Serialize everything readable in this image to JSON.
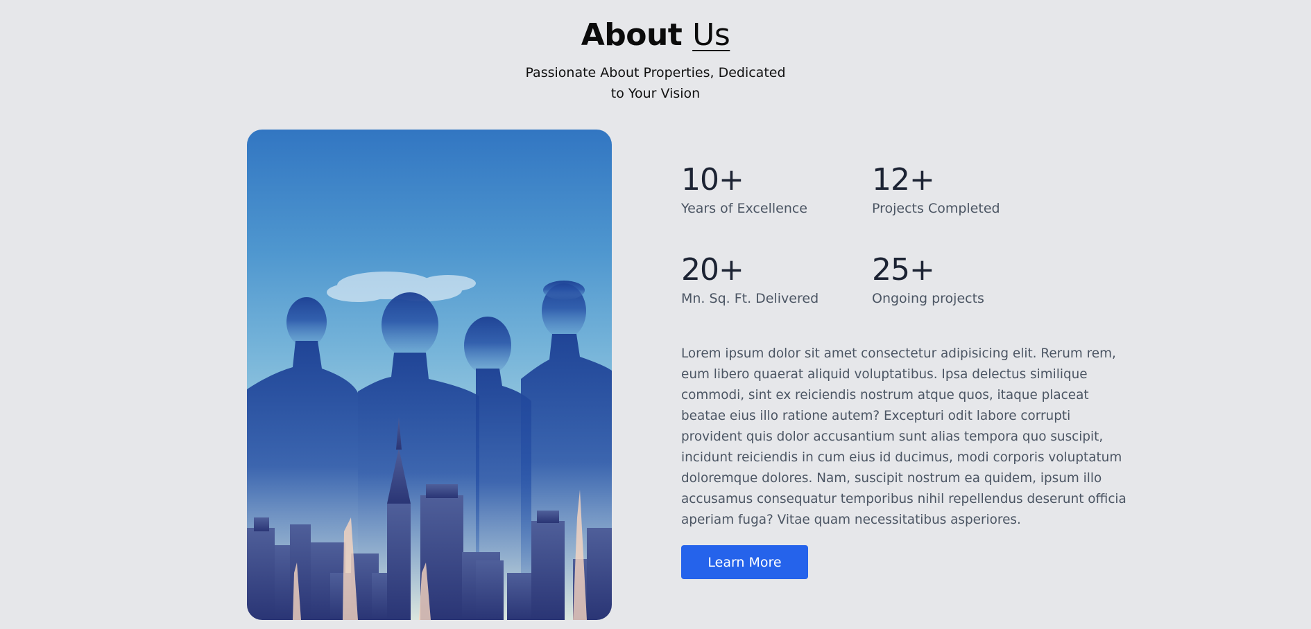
{
  "header": {
    "title_bold": "About",
    "title_light": "Us",
    "subtitle": "Passionate About Properties, Dedicated to Your Vision"
  },
  "stats": [
    {
      "value": "10+",
      "label": "Years of Excellence"
    },
    {
      "value": "12+",
      "label": "Projects Completed"
    },
    {
      "value": "20+",
      "label": "Mn. Sq. Ft. Delivered"
    },
    {
      "value": "25+",
      "label": "Ongoing projects"
    }
  ],
  "description": "Lorem ipsum dolor sit amet consectetur adipisicing elit. Rerum rem, eum libero quaerat aliquid voluptatibus. Ipsa delectus similique commodi, sint ex reiciendis nostrum atque quos, itaque placeat beatae eius illo ratione autem? Excepturi odit labore corrupti provident quis dolor accusantium sunt alias tempora quo suscipit, incidunt reiciendis in cum eius id ducimus, modi corporis voluptatum doloremque dolores. Nam, suscipit nostrum ea quidem, ipsum illo accusamus consequatur temporibus nihil repellendus deserunt officia aperiam fuga? Vitae quam necessitatibus asperiores.",
  "cta": {
    "label": "Learn More"
  },
  "colors": {
    "background": "#e6e7ea",
    "accent": "#2563eb",
    "heading": "#0b0b0b",
    "stat_number": "#1c2333",
    "muted_text": "#4b5563"
  },
  "image": {
    "icon": "team-silhouettes-city-skyline-image"
  }
}
